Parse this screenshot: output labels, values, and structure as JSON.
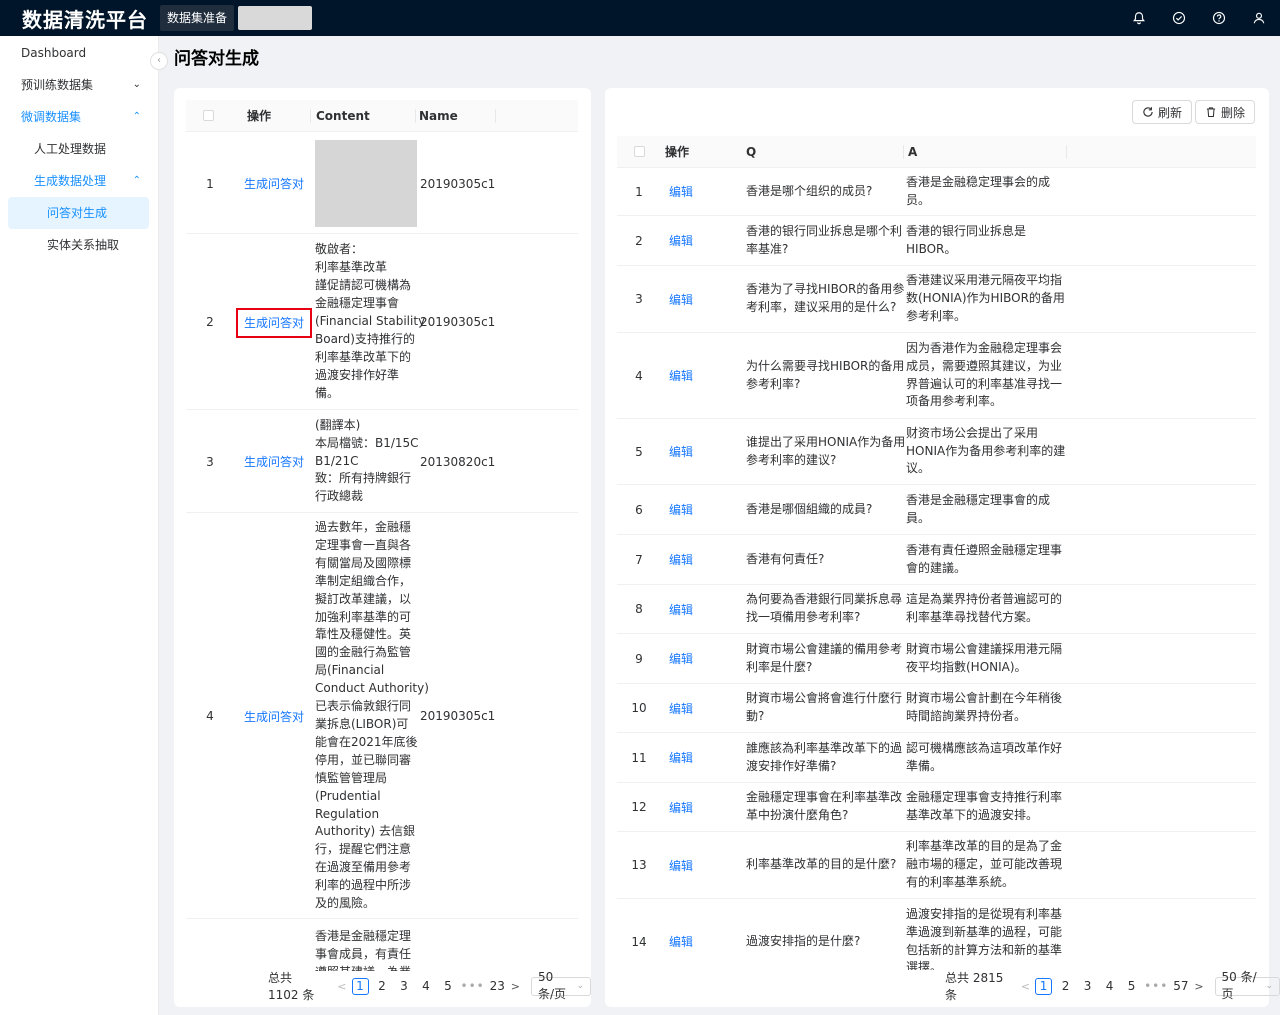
{
  "app": {
    "brand": "数据清洗平台",
    "top_tab": "数据集准备"
  },
  "sidebar": {
    "items": [
      {
        "label": "Dashboard"
      },
      {
        "label": "预训练数据集"
      },
      {
        "label": "微调数据集"
      },
      {
        "label": "人工处理数据"
      },
      {
        "label": "生成数据处理"
      },
      {
        "label": "问答对生成"
      },
      {
        "label": "实体关系抽取"
      }
    ]
  },
  "page": {
    "title": "问答对生成"
  },
  "left_table": {
    "headers": {
      "op": "操作",
      "content": "Content",
      "name": "Name"
    },
    "rows": [
      {
        "idx": "1",
        "op": "生成问答对",
        "content": "",
        "name": "20190305c1"
      },
      {
        "idx": "2",
        "op": "生成问答对",
        "content": "敬啟者：\n利率基準改革\n謹促請認可機構為\n金融穩定理事會\n(Financial Stability\nBoard)支持推行的\n利率基準改革下的\n過渡安排作好準\n備。",
        "name": "20190305c1"
      },
      {
        "idx": "3",
        "op": "生成问答对",
        "content": "(翻譯本)\n本局檔號：B1/15C\nB1/21C\n致：所有持牌銀行\n行政總裁",
        "name": "20130820c1"
      },
      {
        "idx": "4",
        "op": "生成问答对",
        "content": "過去數年，金融穩\n定理事會一直與各\n有關當局及國際標\n準制定組織合作，\n擬訂改革建議，以\n加強利率基準的可\n靠性及穩健性。英\n國的金融行為監管\n局(Financial\nConduct Authority)\n已表示倫敦銀行同\n業拆息(LIBOR)可\n能會在2021年底後\n停用，並已聯同審\n慎監管管理局\n(Prudential\nRegulation\nAuthority) 去信銀\n行，提醒它們注意\n在過渡至備用參考\n利率的過程中所涉\n及的風險。",
        "name": "20190305c1"
      },
      {
        "idx": "",
        "op": "",
        "content": "香港是金融穩定理\n事會成員，有責任\n遵照其建議，為業",
        "name": ""
      }
    ],
    "pagination": {
      "total": "总共 1102 条",
      "pages": [
        "1",
        "2",
        "3",
        "4",
        "5"
      ],
      "last": "23",
      "page_size": "50 条/页"
    }
  },
  "right_table": {
    "buttons": {
      "refresh": "刷新",
      "delete": "删除"
    },
    "headers": {
      "op": "操作",
      "q": "Q",
      "a": "A"
    },
    "rows": [
      {
        "idx": "1",
        "op": "编辑",
        "q": "香港是哪个组织的成员?",
        "a": "香港是金融稳定理事会的成\n员。"
      },
      {
        "idx": "2",
        "op": "编辑",
        "q": "香港的银行同业拆息是哪个利\n率基准?",
        "a": "香港的银行同业拆息是\nHIBOR。"
      },
      {
        "idx": "3",
        "op": "编辑",
        "q": "香港为了寻找HIBOR的备用参\n考利率，建议采用的是什么?",
        "a": "香港建议采用港元隔夜平均指\n数(HONIA)作为HIBOR的备用\n参考利率。"
      },
      {
        "idx": "4",
        "op": "编辑",
        "q": "为什么需要寻找HIBOR的备用\n参考利率?",
        "a": "因为香港作为金融稳定理事会\n成员，需要遵照其建议，为业\n界普遍认可的利率基准寻找一\n项备用参考利率。"
      },
      {
        "idx": "5",
        "op": "编辑",
        "q": "谁提出了采用HONIA作为备用\n参考利率的建议?",
        "a": "财资市场公会提出了采用\nHONIA作为备用参考利率的建\n议。"
      },
      {
        "idx": "6",
        "op": "编辑",
        "q": "香港是哪個組織的成員?",
        "a": "香港是金融穩定理事會的成\n員。"
      },
      {
        "idx": "7",
        "op": "编辑",
        "q": "香港有何責任?",
        "a": "香港有責任遵照金融穩定理事\n會的建議。"
      },
      {
        "idx": "8",
        "op": "编辑",
        "q": "為何要為香港銀行同業拆息尋\n找一項備用參考利率?",
        "a": "這是為業界持份者普遍認可的\n利率基準尋找替代方案。"
      },
      {
        "idx": "9",
        "op": "编辑",
        "q": "財資市場公會建議的備用參考\n利率是什麼?",
        "a": "財資市場公會建議採用港元隔\n夜平均指數(HONIA)。"
      },
      {
        "idx": "10",
        "op": "编辑",
        "q": "財資市場公會將會進行什麼行\n動?",
        "a": "財資市場公會計劃在今年稍後\n時間諮詢業界持份者。"
      },
      {
        "idx": "11",
        "op": "编辑",
        "q": "誰應該為利率基準改革下的過\n渡安排作好準備?",
        "a": "認可機構應該為這項改革作好\n準備。"
      },
      {
        "idx": "12",
        "op": "编辑",
        "q": "金融穩定理事會在利率基準改\n革中扮演什麼角色?",
        "a": "金融穩定理事會支持推行利率\n基準改革下的過渡安排。"
      },
      {
        "idx": "13",
        "op": "编辑",
        "q": "利率基準改革的目的是什麼?",
        "a": "利率基準改革的目的是為了金\n融市場的穩定，並可能改善現\n有的利率基準系統。"
      },
      {
        "idx": "14",
        "op": "编辑",
        "q": "過渡安排指的是什麼?",
        "a": "過渡安排指的是從現有利率基\n準過渡到新基準的過程，可能\n包括新的計算方法和新的基準\n選擇。"
      }
    ],
    "pagination": {
      "total": "总共 2815 条",
      "pages": [
        "1",
        "2",
        "3",
        "4",
        "5"
      ],
      "last": "57",
      "page_size": "50 条/页"
    }
  }
}
